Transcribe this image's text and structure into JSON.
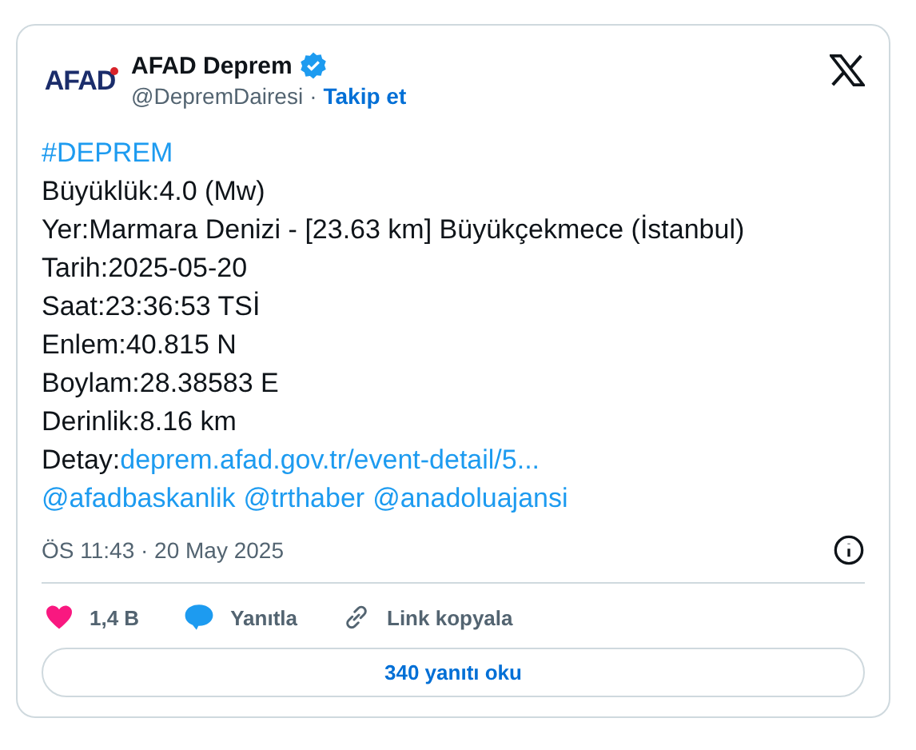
{
  "author": {
    "logo": "AFAD",
    "name": "AFAD Deprem",
    "verified": true,
    "handle": "@DepremDairesi",
    "separator": "·",
    "follow": "Takip et"
  },
  "body": [
    [
      {
        "kind": "link",
        "text": "#DEPREM"
      }
    ],
    [
      {
        "kind": "text",
        "text": "Büyüklük:4.0 (Mw)"
      }
    ],
    [
      {
        "kind": "text",
        "text": "Yer:Marmara Denizi - [23.63 km] Büyükçekmece (İstanbul)"
      }
    ],
    [
      {
        "kind": "text",
        "text": "Tarih:2025-05-20"
      }
    ],
    [
      {
        "kind": "text",
        "text": "Saat:23:36:53 TSİ"
      }
    ],
    [
      {
        "kind": "text",
        "text": "Enlem:40.815 N"
      }
    ],
    [
      {
        "kind": "text",
        "text": "Boylam:28.38583 E"
      }
    ],
    [
      {
        "kind": "text",
        "text": "Derinlik:8.16 km"
      }
    ],
    [
      {
        "kind": "text",
        "text": "Detay:"
      },
      {
        "kind": "link",
        "text": "deprem.afad.gov.tr/event-detail/5..."
      }
    ],
    [
      {
        "kind": "link",
        "text": "@afadbaskanlik"
      },
      {
        "kind": "link",
        "text": "@trthaber"
      },
      {
        "kind": "link",
        "text": "@anadoluajansi"
      }
    ]
  ],
  "timestamp": "ÖS 11:43 · 20 May 2025",
  "actions": [
    {
      "kind": "like",
      "label": "1,4 B"
    },
    {
      "kind": "reply",
      "label": "Yanıtla"
    },
    {
      "kind": "copy",
      "label": "Link kopyala"
    }
  ],
  "replies_button": "340 yanıtı oku"
}
